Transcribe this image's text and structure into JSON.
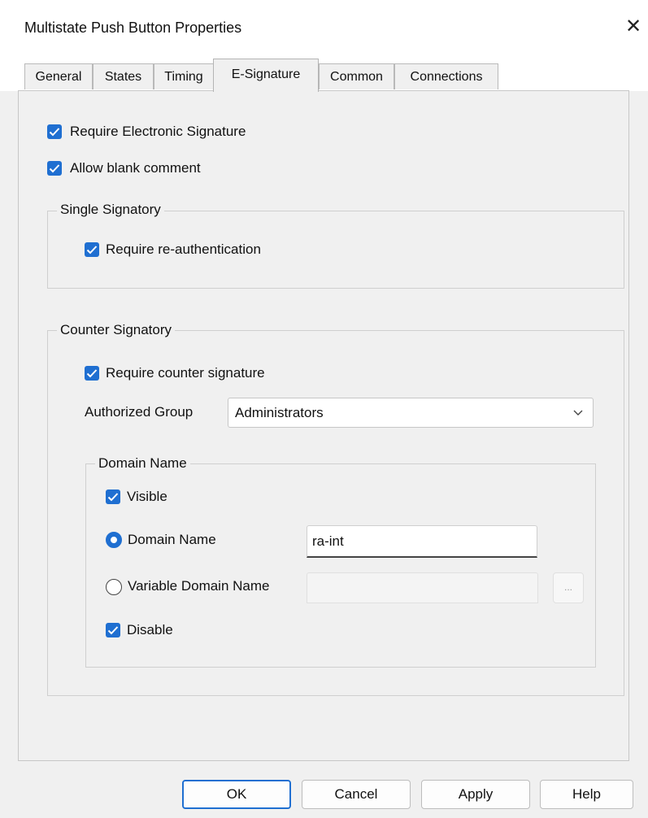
{
  "window": {
    "title": "Multistate Push Button Properties",
    "close_glyph": "✕"
  },
  "tabs": [
    {
      "label": "General"
    },
    {
      "label": "States"
    },
    {
      "label": "Timing"
    },
    {
      "label": "E-Signature",
      "active": true
    },
    {
      "label": "Common"
    },
    {
      "label": "Connections"
    }
  ],
  "esig": {
    "require_signature": {
      "label": "Require Electronic Signature",
      "checked": true
    },
    "allow_blank": {
      "label": "Allow blank comment",
      "checked": true
    },
    "single": {
      "title": "Single Signatory",
      "reauth": {
        "label": "Require re-authentication",
        "checked": true
      }
    },
    "counter": {
      "title": "Counter Signatory",
      "require_counter": {
        "label": "Require counter signature",
        "checked": true
      },
      "group_label": "Authorized Group",
      "group_value": "Administrators",
      "domain": {
        "title": "Domain Name",
        "visible": {
          "label": "Visible",
          "checked": true
        },
        "domain_name_radio": {
          "label": "Domain Name",
          "selected": true
        },
        "domain_name_value": "ra-int",
        "variable_radio": {
          "label": "Variable Domain Name",
          "selected": false
        },
        "variable_value": "",
        "browse_label": "...",
        "disable": {
          "label": "Disable",
          "checked": true
        }
      }
    }
  },
  "buttons": {
    "ok": "OK",
    "cancel": "Cancel",
    "apply": "Apply",
    "help": "Help"
  },
  "colors": {
    "accent": "#1f6fd1",
    "panel": "#f0f0f0",
    "titlebar": "#ffffff"
  }
}
